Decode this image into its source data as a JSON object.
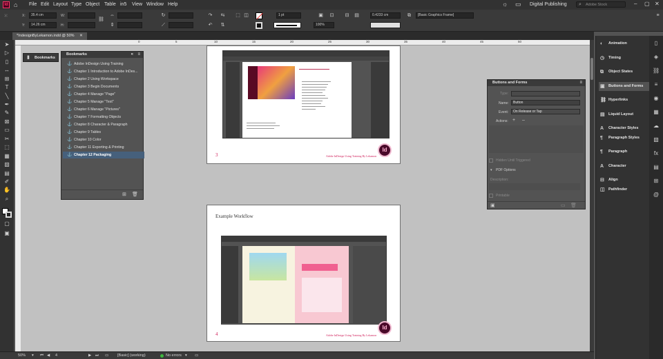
{
  "menubar": {
    "app_icon": "Id",
    "items": [
      "File",
      "Edit",
      "Layout",
      "Type",
      "Object",
      "Table",
      "in5",
      "View",
      "Window",
      "Help"
    ],
    "workspace": "Digital Publishing",
    "search_placeholder": "Adobe Stock"
  },
  "control": {
    "x_label": "X:",
    "x_value": "35.4 cm",
    "y_label": "Y:",
    "y_value": "14.26 cm",
    "w_label": "W:",
    "h_label": "H:",
    "stroke_weight": "1 pt",
    "zoom_pct": "100%",
    "offset_value": "0.4233 cm",
    "frame_style": "[Basic Graphics Frame]"
  },
  "document_tab": {
    "title": "*IndesignByLekamon.indd @ 50%"
  },
  "ruler": {
    "labels": [
      "0",
      "5",
      "10",
      "15",
      "20",
      "25",
      "30",
      "35",
      "40",
      "45",
      "50"
    ]
  },
  "bookmarks_panel": {
    "tab_label": "Bookmarks",
    "title": "Bookmarks",
    "items": [
      {
        "label": "Adobe InDesign Using Training",
        "selected": false
      },
      {
        "label": "Chapter 1 Introduction to Adobe InDes...",
        "selected": false
      },
      {
        "label": "Chapter 2  Using Workspace",
        "selected": false
      },
      {
        "label": "Chapter 3 Begin Documents",
        "selected": false
      },
      {
        "label": "Chapter 4 Manage \"Page\"",
        "selected": false
      },
      {
        "label": "Chapter 5 Manage \"Text\"",
        "selected": false
      },
      {
        "label": "Chapter 6 Manage \"Pictures\"",
        "selected": false
      },
      {
        "label": "Chapter 7 Formatting Objects",
        "selected": false
      },
      {
        "label": "Chapter 8 Character & Paragraph",
        "selected": false
      },
      {
        "label": "Chapter 9 Tables",
        "selected": false
      },
      {
        "label": "Chapter 10 Color",
        "selected": false
      },
      {
        "label": "Chapter 11 Exporting & Printing",
        "selected": false
      },
      {
        "label": "Chapter 12 Packaging",
        "selected": true
      }
    ]
  },
  "buttons_panel": {
    "title": "Buttons and Forms",
    "type_label": "Type:",
    "name_label": "Name:",
    "name_value": "Button",
    "event_label": "Event:",
    "event_value": "On Release or Tap",
    "actions_label": "Actions:",
    "hidden_label": "Hidden Until Triggered",
    "pdf_options_label": "PDF Options",
    "description_label": "Description:",
    "printable_label": "Printable"
  },
  "dock": {
    "items": [
      {
        "label": "Animation",
        "icon": "animation-icon"
      },
      {
        "label": "Timing",
        "icon": "timing-icon"
      },
      {
        "label": "Object States",
        "icon": "object-states-icon"
      },
      {
        "label": "Buttons and Forms",
        "icon": "buttons-forms-icon"
      },
      {
        "label": "Hyperlinks",
        "icon": "hyperlinks-icon"
      },
      {
        "label": "Liquid Layout",
        "icon": "liquid-layout-icon"
      },
      {
        "label": "Character Styles",
        "icon": "character-styles-icon"
      },
      {
        "label": "Paragraph Styles",
        "icon": "paragraph-styles-icon"
      },
      {
        "label": "Paragraph",
        "icon": "paragraph-icon"
      },
      {
        "label": "Character",
        "icon": "character-icon"
      },
      {
        "label": "Align",
        "icon": "align-icon"
      },
      {
        "label": "Pathfinder",
        "icon": "pathfinder-icon"
      }
    ]
  },
  "pages": {
    "page3_number": "3",
    "page3_footer": "Adobe InDesign Using Training By Lekamon",
    "page4_title": "Example Workflow",
    "page4_number": "4",
    "page4_footer": "Adobe InDesign Using Training By Lekamon",
    "logo_text": "Id"
  },
  "statusbar": {
    "zoom": "50%",
    "page": "4",
    "style": "[Basic] (working)",
    "errors": "No errors"
  },
  "colors": {
    "accent_pink": "#d0215c",
    "selection_blue": "#46607c",
    "no_errors_green": "#3fb93f"
  }
}
